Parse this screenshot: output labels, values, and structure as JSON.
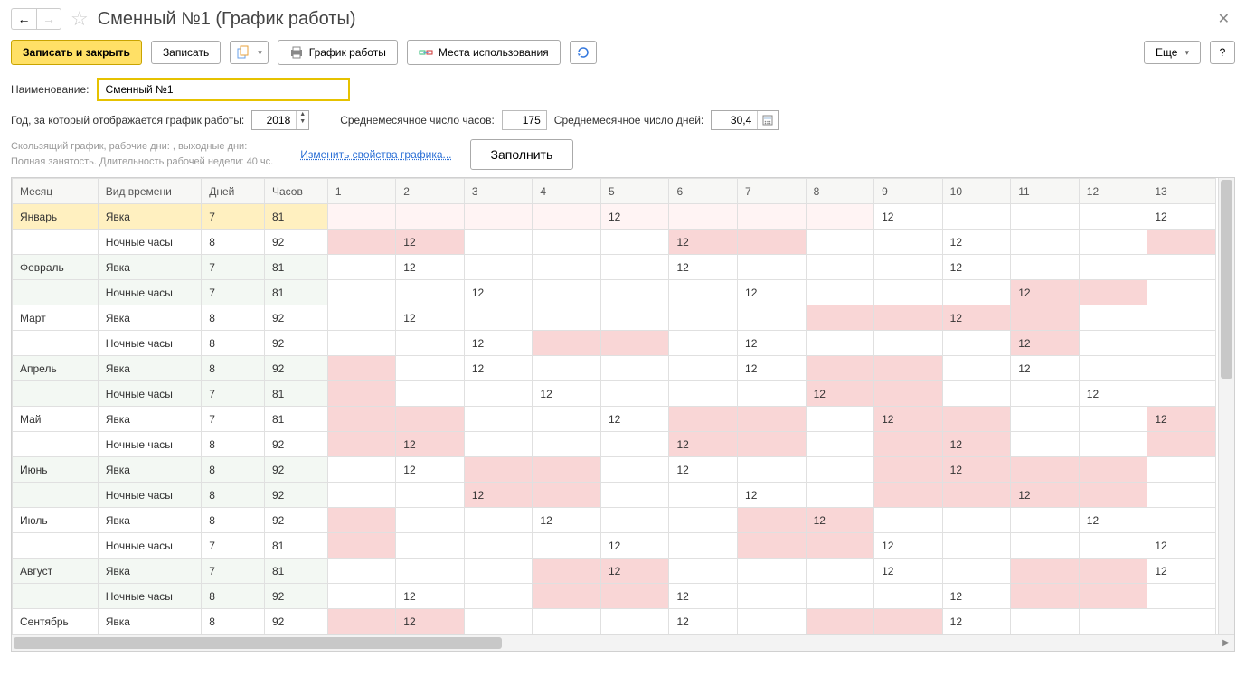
{
  "header": {
    "title": "Сменный №1 (График работы)"
  },
  "toolbar": {
    "save_close": "Записать и закрыть",
    "save": "Записать",
    "schedule": "График работы",
    "usage": "Места использования",
    "more": "Еще",
    "help": "?"
  },
  "form": {
    "name_label": "Наименование:",
    "name_value": "Сменный №1",
    "year_label": "Год, за который отображается график работы:",
    "year_value": "2018",
    "avg_hours_label": "Среднемесячное число часов:",
    "avg_hours_value": "175",
    "avg_days_label": "Среднемесячное число дней:",
    "avg_days_value": "30,4"
  },
  "desc": {
    "line1": "Скользящий график, рабочие дни: , выходные дни:",
    "line2": "Полная занятость. Длительность рабочей недели: 40 чс.",
    "change_link": "Изменить свойства графика...",
    "fill_btn": "Заполнить"
  },
  "table": {
    "headers": {
      "month": "Месяц",
      "type": "Вид времени",
      "days": "Дней",
      "hours": "Часов"
    },
    "day_cols": [
      "1",
      "2",
      "3",
      "4",
      "5",
      "6",
      "7",
      "8",
      "9",
      "10",
      "11",
      "12",
      "13"
    ],
    "rows": [
      {
        "month": "Январь",
        "type": "Явка",
        "days": "7",
        "hours": "81",
        "hl": true,
        "odd": true,
        "cells": [
          {
            "t": "",
            "c": "pale-pink"
          },
          {
            "t": "",
            "c": "pale-pink"
          },
          {
            "t": "",
            "c": "pale-pink"
          },
          {
            "t": "",
            "c": "pale-pink"
          },
          {
            "t": "12",
            "c": "pale-pink"
          },
          {
            "t": "",
            "c": "pale-pink"
          },
          {
            "t": "",
            "c": "pale-pink"
          },
          {
            "t": "",
            "c": "pale-pink"
          },
          {
            "t": "12",
            "c": ""
          },
          {
            "t": "",
            "c": ""
          },
          {
            "t": "",
            "c": ""
          },
          {
            "t": "",
            "c": ""
          },
          {
            "t": "12",
            "c": ""
          }
        ]
      },
      {
        "month": "",
        "type": "Ночные часы",
        "days": "8",
        "hours": "92",
        "odd": true,
        "cells": [
          {
            "t": "",
            "c": "pink"
          },
          {
            "t": "12",
            "c": "pink"
          },
          {
            "t": "",
            "c": ""
          },
          {
            "t": "",
            "c": ""
          },
          {
            "t": "",
            "c": ""
          },
          {
            "t": "12",
            "c": "pink"
          },
          {
            "t": "",
            "c": "pink"
          },
          {
            "t": "",
            "c": ""
          },
          {
            "t": "",
            "c": ""
          },
          {
            "t": "12",
            "c": ""
          },
          {
            "t": "",
            "c": ""
          },
          {
            "t": "",
            "c": ""
          },
          {
            "t": "",
            "c": "pink"
          }
        ]
      },
      {
        "month": "Февраль",
        "type": "Явка",
        "days": "7",
        "hours": "81",
        "odd": false,
        "cells": [
          {
            "t": "",
            "c": ""
          },
          {
            "t": "12",
            "c": ""
          },
          {
            "t": "",
            "c": ""
          },
          {
            "t": "",
            "c": ""
          },
          {
            "t": "",
            "c": ""
          },
          {
            "t": "12",
            "c": ""
          },
          {
            "t": "",
            "c": ""
          },
          {
            "t": "",
            "c": ""
          },
          {
            "t": "",
            "c": ""
          },
          {
            "t": "12",
            "c": ""
          },
          {
            "t": "",
            "c": ""
          },
          {
            "t": "",
            "c": ""
          },
          {
            "t": "",
            "c": ""
          }
        ]
      },
      {
        "month": "",
        "type": "Ночные часы",
        "days": "7",
        "hours": "81",
        "odd": false,
        "cells": [
          {
            "t": "",
            "c": ""
          },
          {
            "t": "",
            "c": ""
          },
          {
            "t": "12",
            "c": ""
          },
          {
            "t": "",
            "c": ""
          },
          {
            "t": "",
            "c": ""
          },
          {
            "t": "",
            "c": ""
          },
          {
            "t": "12",
            "c": ""
          },
          {
            "t": "",
            "c": ""
          },
          {
            "t": "",
            "c": ""
          },
          {
            "t": "",
            "c": ""
          },
          {
            "t": "12",
            "c": "pink"
          },
          {
            "t": "",
            "c": "pink"
          },
          {
            "t": "",
            "c": ""
          }
        ]
      },
      {
        "month": "Март",
        "type": "Явка",
        "days": "8",
        "hours": "92",
        "odd": true,
        "cells": [
          {
            "t": "",
            "c": ""
          },
          {
            "t": "12",
            "c": ""
          },
          {
            "t": "",
            "c": ""
          },
          {
            "t": "",
            "c": ""
          },
          {
            "t": "",
            "c": ""
          },
          {
            "t": "",
            "c": ""
          },
          {
            "t": "",
            "c": ""
          },
          {
            "t": "",
            "c": "pink"
          },
          {
            "t": "",
            "c": "pink"
          },
          {
            "t": "12",
            "c": "pink"
          },
          {
            "t": "",
            "c": "pink"
          },
          {
            "t": "",
            "c": ""
          },
          {
            "t": "",
            "c": ""
          }
        ]
      },
      {
        "month": "",
        "type": "Ночные часы",
        "days": "8",
        "hours": "92",
        "odd": true,
        "cells": [
          {
            "t": "",
            "c": ""
          },
          {
            "t": "",
            "c": ""
          },
          {
            "t": "12",
            "c": ""
          },
          {
            "t": "",
            "c": "pink"
          },
          {
            "t": "",
            "c": "pink"
          },
          {
            "t": "",
            "c": ""
          },
          {
            "t": "12",
            "c": ""
          },
          {
            "t": "",
            "c": ""
          },
          {
            "t": "",
            "c": ""
          },
          {
            "t": "",
            "c": ""
          },
          {
            "t": "12",
            "c": "pink"
          },
          {
            "t": "",
            "c": ""
          },
          {
            "t": "",
            "c": ""
          }
        ]
      },
      {
        "month": "Апрель",
        "type": "Явка",
        "days": "8",
        "hours": "92",
        "odd": false,
        "cells": [
          {
            "t": "",
            "c": "pink"
          },
          {
            "t": "",
            "c": ""
          },
          {
            "t": "12",
            "c": ""
          },
          {
            "t": "",
            "c": ""
          },
          {
            "t": "",
            "c": ""
          },
          {
            "t": "",
            "c": ""
          },
          {
            "t": "12",
            "c": ""
          },
          {
            "t": "",
            "c": "pink"
          },
          {
            "t": "",
            "c": "pink"
          },
          {
            "t": "",
            "c": ""
          },
          {
            "t": "12",
            "c": ""
          },
          {
            "t": "",
            "c": ""
          },
          {
            "t": "",
            "c": ""
          }
        ]
      },
      {
        "month": "",
        "type": "Ночные часы",
        "days": "7",
        "hours": "81",
        "odd": false,
        "cells": [
          {
            "t": "",
            "c": "pink"
          },
          {
            "t": "",
            "c": ""
          },
          {
            "t": "",
            "c": ""
          },
          {
            "t": "12",
            "c": ""
          },
          {
            "t": "",
            "c": ""
          },
          {
            "t": "",
            "c": ""
          },
          {
            "t": "",
            "c": ""
          },
          {
            "t": "12",
            "c": "pink"
          },
          {
            "t": "",
            "c": "pink"
          },
          {
            "t": "",
            "c": ""
          },
          {
            "t": "",
            "c": ""
          },
          {
            "t": "12",
            "c": ""
          },
          {
            "t": "",
            "c": ""
          }
        ]
      },
      {
        "month": "Май",
        "type": "Явка",
        "days": "7",
        "hours": "81",
        "odd": true,
        "cells": [
          {
            "t": "",
            "c": "pink"
          },
          {
            "t": "",
            "c": "pink"
          },
          {
            "t": "",
            "c": ""
          },
          {
            "t": "",
            "c": ""
          },
          {
            "t": "12",
            "c": ""
          },
          {
            "t": "",
            "c": "pink"
          },
          {
            "t": "",
            "c": "pink"
          },
          {
            "t": "",
            "c": ""
          },
          {
            "t": "12",
            "c": "pink"
          },
          {
            "t": "",
            "c": "pink"
          },
          {
            "t": "",
            "c": ""
          },
          {
            "t": "",
            "c": ""
          },
          {
            "t": "12",
            "c": "pink"
          }
        ]
      },
      {
        "month": "",
        "type": "Ночные часы",
        "days": "8",
        "hours": "92",
        "odd": true,
        "cells": [
          {
            "t": "",
            "c": "pink"
          },
          {
            "t": "12",
            "c": "pink"
          },
          {
            "t": "",
            "c": ""
          },
          {
            "t": "",
            "c": ""
          },
          {
            "t": "",
            "c": ""
          },
          {
            "t": "12",
            "c": "pink"
          },
          {
            "t": "",
            "c": "pink"
          },
          {
            "t": "",
            "c": ""
          },
          {
            "t": "",
            "c": "pink"
          },
          {
            "t": "12",
            "c": "pink"
          },
          {
            "t": "",
            "c": ""
          },
          {
            "t": "",
            "c": ""
          },
          {
            "t": "",
            "c": "pink"
          }
        ]
      },
      {
        "month": "Июнь",
        "type": "Явка",
        "days": "8",
        "hours": "92",
        "odd": false,
        "cells": [
          {
            "t": "",
            "c": ""
          },
          {
            "t": "12",
            "c": ""
          },
          {
            "t": "",
            "c": "pink"
          },
          {
            "t": "",
            "c": "pink"
          },
          {
            "t": "",
            "c": ""
          },
          {
            "t": "12",
            "c": ""
          },
          {
            "t": "",
            "c": ""
          },
          {
            "t": "",
            "c": ""
          },
          {
            "t": "",
            "c": "pink"
          },
          {
            "t": "12",
            "c": "pink"
          },
          {
            "t": "",
            "c": "pink"
          },
          {
            "t": "",
            "c": "pink"
          },
          {
            "t": "",
            "c": ""
          }
        ]
      },
      {
        "month": "",
        "type": "Ночные часы",
        "days": "8",
        "hours": "92",
        "odd": false,
        "cells": [
          {
            "t": "",
            "c": ""
          },
          {
            "t": "",
            "c": ""
          },
          {
            "t": "12",
            "c": "pink"
          },
          {
            "t": "",
            "c": "pink"
          },
          {
            "t": "",
            "c": ""
          },
          {
            "t": "",
            "c": ""
          },
          {
            "t": "12",
            "c": ""
          },
          {
            "t": "",
            "c": ""
          },
          {
            "t": "",
            "c": "pink"
          },
          {
            "t": "",
            "c": "pink"
          },
          {
            "t": "12",
            "c": "pink"
          },
          {
            "t": "",
            "c": "pink"
          },
          {
            "t": "",
            "c": ""
          }
        ]
      },
      {
        "month": "Июль",
        "type": "Явка",
        "days": "8",
        "hours": "92",
        "odd": true,
        "cells": [
          {
            "t": "",
            "c": "pink"
          },
          {
            "t": "",
            "c": ""
          },
          {
            "t": "",
            "c": ""
          },
          {
            "t": "12",
            "c": ""
          },
          {
            "t": "",
            "c": ""
          },
          {
            "t": "",
            "c": ""
          },
          {
            "t": "",
            "c": "pink"
          },
          {
            "t": "12",
            "c": "pink"
          },
          {
            "t": "",
            "c": ""
          },
          {
            "t": "",
            "c": ""
          },
          {
            "t": "",
            "c": ""
          },
          {
            "t": "12",
            "c": ""
          },
          {
            "t": "",
            "c": ""
          }
        ]
      },
      {
        "month": "",
        "type": "Ночные часы",
        "days": "7",
        "hours": "81",
        "odd": true,
        "cells": [
          {
            "t": "",
            "c": "pink"
          },
          {
            "t": "",
            "c": ""
          },
          {
            "t": "",
            "c": ""
          },
          {
            "t": "",
            "c": ""
          },
          {
            "t": "12",
            "c": ""
          },
          {
            "t": "",
            "c": ""
          },
          {
            "t": "",
            "c": "pink"
          },
          {
            "t": "",
            "c": "pink"
          },
          {
            "t": "12",
            "c": ""
          },
          {
            "t": "",
            "c": ""
          },
          {
            "t": "",
            "c": ""
          },
          {
            "t": "",
            "c": ""
          },
          {
            "t": "12",
            "c": ""
          }
        ]
      },
      {
        "month": "Август",
        "type": "Явка",
        "days": "7",
        "hours": "81",
        "odd": false,
        "cells": [
          {
            "t": "",
            "c": ""
          },
          {
            "t": "",
            "c": ""
          },
          {
            "t": "",
            "c": ""
          },
          {
            "t": "",
            "c": "pink"
          },
          {
            "t": "12",
            "c": "pink"
          },
          {
            "t": "",
            "c": ""
          },
          {
            "t": "",
            "c": ""
          },
          {
            "t": "",
            "c": ""
          },
          {
            "t": "12",
            "c": ""
          },
          {
            "t": "",
            "c": ""
          },
          {
            "t": "",
            "c": "pink"
          },
          {
            "t": "",
            "c": "pink"
          },
          {
            "t": "12",
            "c": ""
          }
        ]
      },
      {
        "month": "",
        "type": "Ночные часы",
        "days": "8",
        "hours": "92",
        "odd": false,
        "cells": [
          {
            "t": "",
            "c": ""
          },
          {
            "t": "12",
            "c": ""
          },
          {
            "t": "",
            "c": ""
          },
          {
            "t": "",
            "c": "pink"
          },
          {
            "t": "",
            "c": "pink"
          },
          {
            "t": "12",
            "c": ""
          },
          {
            "t": "",
            "c": ""
          },
          {
            "t": "",
            "c": ""
          },
          {
            "t": "",
            "c": ""
          },
          {
            "t": "12",
            "c": ""
          },
          {
            "t": "",
            "c": "pink"
          },
          {
            "t": "",
            "c": "pink"
          },
          {
            "t": "",
            "c": ""
          }
        ]
      },
      {
        "month": "Сентябрь",
        "type": "Явка",
        "days": "8",
        "hours": "92",
        "odd": true,
        "cells": [
          {
            "t": "",
            "c": "pink"
          },
          {
            "t": "12",
            "c": "pink"
          },
          {
            "t": "",
            "c": ""
          },
          {
            "t": "",
            "c": ""
          },
          {
            "t": "",
            "c": ""
          },
          {
            "t": "12",
            "c": ""
          },
          {
            "t": "",
            "c": ""
          },
          {
            "t": "",
            "c": "pink"
          },
          {
            "t": "",
            "c": "pink"
          },
          {
            "t": "12",
            "c": ""
          },
          {
            "t": "",
            "c": ""
          },
          {
            "t": "",
            "c": ""
          },
          {
            "t": "",
            "c": ""
          }
        ]
      }
    ]
  }
}
